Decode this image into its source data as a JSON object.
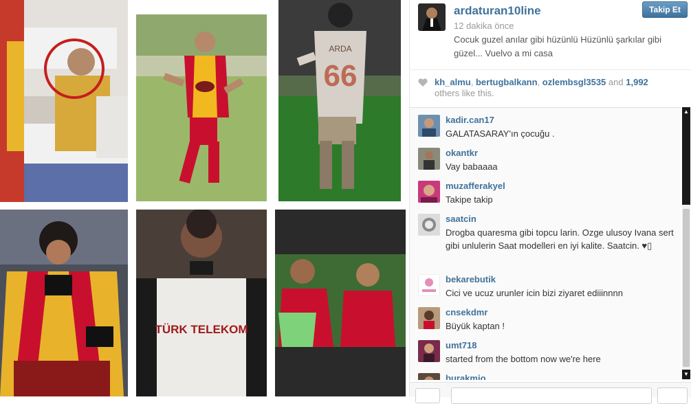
{
  "post": {
    "username": "ardaturan10line",
    "time_ago": "12 dakika önce",
    "caption": "Cocuk guzel anılar gibi hüzünlü Hüzünlü şarkılar gibi güzel... Vuelvo a mi casa",
    "follow_label": "Takip Et"
  },
  "likes": {
    "users": [
      "kh_almu",
      "bertugbalkann",
      "ozlembsgl3535"
    ],
    "and_word": "and",
    "count": "1,992",
    "suffix": "others like this."
  },
  "comments": [
    {
      "user": "kadir.can17",
      "text": "GALATASARAY'ın çocuğu ."
    },
    {
      "user": "okantkr",
      "text": "Vay babaaaa"
    },
    {
      "user": "muzafferakyel",
      "text": "Takipe takip"
    },
    {
      "user": "saatcin",
      "text": "Drogba quaresma gibi topcu larin. Ozge ulusoy Ivana sert gibi unlulerin Saat modelleri en iyi kalite. Saatcin. ♥▯"
    },
    {
      "user": "bekarebutik",
      "text": "Cici ve ucuz urunler icin bizi ziyaret ediiinnnn"
    },
    {
      "user": "cnsekdmr",
      "text": "Büyük kaptan !"
    },
    {
      "user": "umt718",
      "text": "started from the bottom now we're here"
    },
    {
      "user": "burakmio",
      "text": ""
    }
  ],
  "photo_texts": {
    "kit_text": "TÜRK TELEKOM",
    "shirt_number": "66",
    "shirt_name": "ARDA"
  },
  "colors": {
    "link_blue": "#3f729b",
    "gs_red": "#c8102e",
    "gs_yellow": "#f2b81f"
  },
  "icons": {
    "heart": "heart-icon",
    "scroll_up": "arrow-up-icon",
    "scroll_down": "arrow-down-icon"
  }
}
